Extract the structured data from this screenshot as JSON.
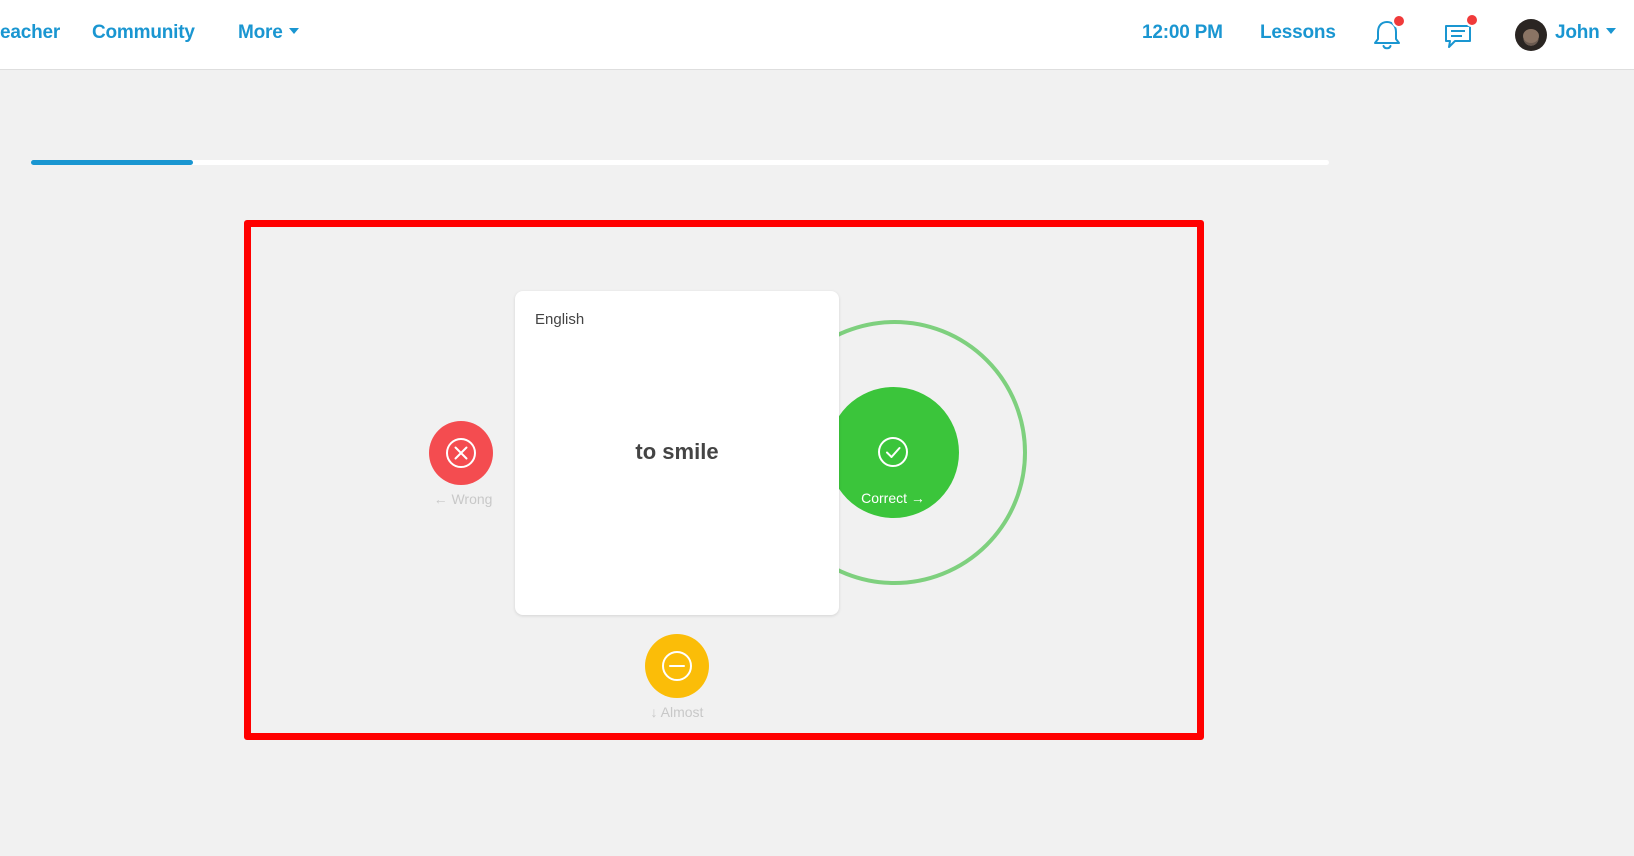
{
  "nav": {
    "teacher": "eacher",
    "community": "Community",
    "more": "More",
    "time": "12:00 PM",
    "lessons": "Lessons",
    "user": "John"
  },
  "progress": {
    "percent": 12.5
  },
  "card": {
    "language": "English",
    "word": "to smile"
  },
  "actions": {
    "correct": "Correct →",
    "wrong": "← Wrong",
    "almost": "↓ Almost"
  },
  "colors": {
    "accent": "#1a96d1",
    "correct": "#3bc53b",
    "wrong": "#f44c50",
    "almost": "#fbbd08",
    "highlight": "#ff0000"
  },
  "icons": [
    "notification-bell-icon",
    "messages-icon",
    "check-icon",
    "x-icon",
    "minus-icon",
    "chevron-down-icon"
  ]
}
